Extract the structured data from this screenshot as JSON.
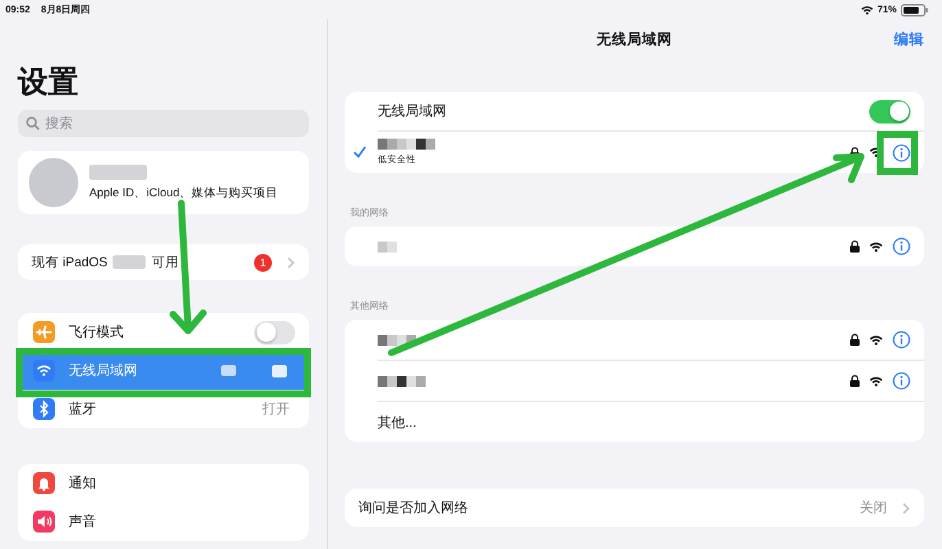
{
  "status_bar": {
    "time": "09:52",
    "date": "8月8日周四",
    "battery": "71%"
  },
  "sidebar": {
    "title": "设置",
    "search": {
      "placeholder": "搜索"
    },
    "profile": {
      "subtitle": "Apple ID、iCloud、媒体与购买项目"
    },
    "update": {
      "label_before": "现有 iPadOS",
      "label_after": "可用",
      "badge": "1"
    },
    "groups": [
      [
        {
          "label": "飞行模式",
          "kind": "toggle",
          "on": false,
          "selected": false
        },
        {
          "label": "无线局域网",
          "kind": "hidden-value",
          "selected": true
        },
        {
          "label": "蓝牙",
          "kind": "value",
          "value": "打开",
          "selected": false
        }
      ],
      [
        {
          "label": "通知",
          "kind": "plain",
          "selected": false
        },
        {
          "label": "声音",
          "kind": "plain",
          "selected": false
        }
      ]
    ]
  },
  "detail": {
    "title": "无线局域网",
    "edit": "编辑",
    "wifi_toggle": {
      "label": "无线局域网",
      "on": true
    },
    "connected": {
      "checked": true,
      "subtitle": "低安全性",
      "locked": true
    },
    "my_networks": {
      "header": "我的网络",
      "networks": [
        {
          "locked": true
        }
      ]
    },
    "other_networks": {
      "header": "其他网络",
      "networks": [
        {
          "locked": true
        },
        {
          "locked": true
        }
      ],
      "other": "其他..."
    },
    "ask_to_join": {
      "label": "询问是否加入网络",
      "value": "关闭"
    }
  }
}
